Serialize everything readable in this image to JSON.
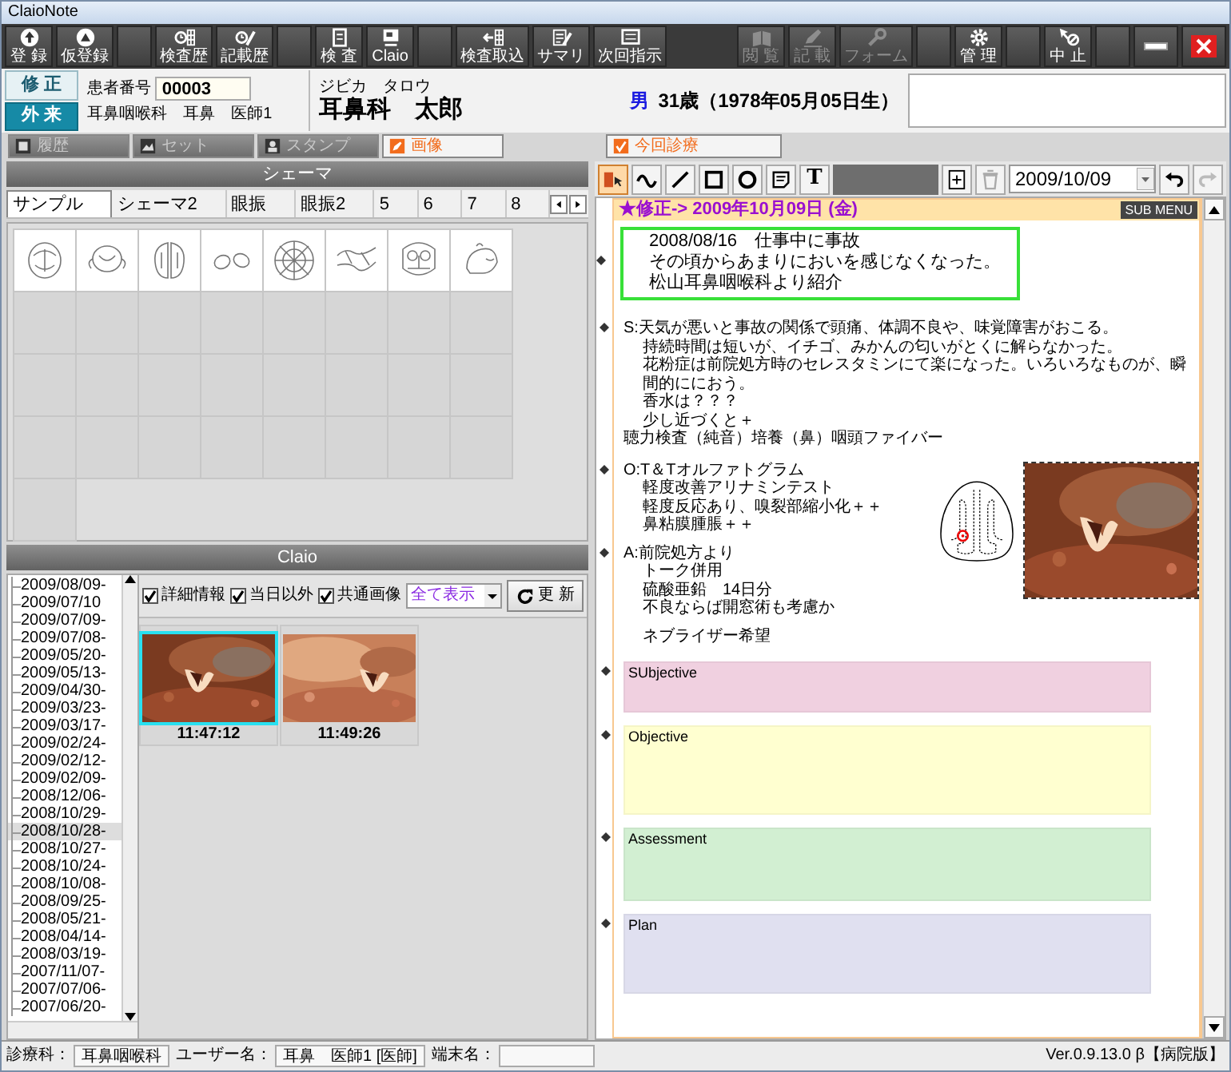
{
  "window": {
    "title": "ClaioNote"
  },
  "toolbar_groups": [
    [
      {
        "label": "登 録",
        "disabled": false
      },
      {
        "label": "仮登録",
        "disabled": false
      }
    ],
    [
      {
        "label": "検査歴",
        "disabled": false
      },
      {
        "label": "記載歴",
        "disabled": false
      }
    ],
    [
      {
        "label": "検 査",
        "disabled": false
      },
      {
        "label": "Claio",
        "disabled": false
      }
    ],
    [
      {
        "label": "検査取込",
        "disabled": false
      },
      {
        "label": "サマリ",
        "disabled": false
      },
      {
        "label": "次回指示",
        "disabled": false
      }
    ],
    [
      {
        "label": "閲 覧",
        "disabled": true
      },
      {
        "label": "記 載",
        "disabled": true
      },
      {
        "label": "フォーム",
        "disabled": true
      }
    ],
    [
      {
        "label": "管 理",
        "disabled": false
      }
    ],
    [
      {
        "label": "中 止",
        "disabled": false
      }
    ]
  ],
  "patient": {
    "edit_button": "修 正",
    "visit_button": "外 来",
    "id_label": "患者番号",
    "id": "00003",
    "department": "耳鼻咽喉科　耳鼻　医師1",
    "kana": "ジビカ　タロウ",
    "name": "耳鼻科　太郎",
    "sex": "男",
    "age": "31歳（1978年05月05日生）"
  },
  "tabs": [
    {
      "label": "履歴",
      "selected": false
    },
    {
      "label": "セット",
      "selected": false
    },
    {
      "label": "スタンプ",
      "selected": false
    },
    {
      "label": "画像",
      "selected": true
    }
  ],
  "chart_tab": {
    "label": "今回診療",
    "selected": true
  },
  "schema": {
    "title": "シェーマ",
    "tabs": [
      {
        "label": "サンプル",
        "selected": true
      },
      {
        "label": "シェーマ2",
        "selected": false
      },
      {
        "label": "眼振",
        "selected": false
      },
      {
        "label": "眼振2",
        "selected": false
      },
      {
        "label": "5",
        "selected": false
      },
      {
        "label": "6",
        "selected": false
      },
      {
        "label": "7",
        "selected": false
      },
      {
        "label": "8",
        "selected": false
      }
    ],
    "items": [
      {
        "kind": "mouth"
      },
      {
        "kind": "ears"
      },
      {
        "kind": "nose"
      },
      {
        "kind": "eyes"
      },
      {
        "kind": "target"
      },
      {
        "kind": "canal"
      },
      {
        "kind": "skull"
      },
      {
        "kind": "head"
      }
    ]
  },
  "claio": {
    "title": "Claio",
    "dates": [
      {
        "label": "2009/08/09-",
        "selected": false
      },
      {
        "label": "2009/07/10",
        "selected": false
      },
      {
        "label": "2009/07/09-",
        "selected": false
      },
      {
        "label": "2009/07/08-",
        "selected": false
      },
      {
        "label": "2009/05/20-",
        "selected": false
      },
      {
        "label": "2009/05/13-",
        "selected": false
      },
      {
        "label": "2009/04/30-",
        "selected": false
      },
      {
        "label": "2009/03/23-",
        "selected": false
      },
      {
        "label": "2009/03/17-",
        "selected": false
      },
      {
        "label": "2009/02/24-",
        "selected": false
      },
      {
        "label": "2009/02/12-",
        "selected": false
      },
      {
        "label": "2009/02/09-",
        "selected": false
      },
      {
        "label": "2008/12/06-",
        "selected": false
      },
      {
        "label": "2008/10/29-",
        "selected": false
      },
      {
        "label": "2008/10/28-",
        "selected": true
      },
      {
        "label": "2008/10/27-",
        "selected": false
      },
      {
        "label": "2008/10/24-",
        "selected": false
      },
      {
        "label": "2008/10/08-",
        "selected": false
      },
      {
        "label": "2008/09/25-",
        "selected": false
      },
      {
        "label": "2008/05/21-",
        "selected": false
      },
      {
        "label": "2008/04/14-",
        "selected": false
      },
      {
        "label": "2008/03/19-",
        "selected": false
      },
      {
        "label": "2007/11/07-",
        "selected": false
      },
      {
        "label": "2007/07/06-",
        "selected": false
      },
      {
        "label": "2007/06/20-",
        "selected": false
      }
    ],
    "filters": [
      {
        "label": "詳細情報",
        "checked": true
      },
      {
        "label": "当日以外",
        "checked": true
      },
      {
        "label": "共通画像",
        "checked": true
      }
    ],
    "view": "全て表示",
    "refresh_button": "更 新",
    "images": [
      {
        "time": "11:47:12",
        "selected": true
      },
      {
        "time": "11:49:26",
        "selected": false
      }
    ]
  },
  "chart": {
    "tools": [
      {
        "selected": true
      },
      {
        "selected": false
      },
      {
        "selected": false
      },
      {
        "selected": false
      },
      {
        "selected": false
      },
      {
        "selected": false
      },
      {
        "selected": false,
        "label": "T"
      }
    ],
    "delete_disabled": true,
    "date": "2009/10/09",
    "undo_disabled": false,
    "redo_disabled": true,
    "header": "★修正-> 2009年10月09日 (金)",
    "sub_menu": "SUB MENU",
    "boxed_lines": [
      {
        "text": "2008/08/16　仕事中に事故",
        "marked": false
      },
      {
        "text": "その頃からあまりにおいを感じなくなった。",
        "marked": true
      },
      {
        "text": "松山耳鼻咽喉科より紹介",
        "marked": false
      }
    ],
    "history": [
      {
        "text": "S:天気が悪いと事故の関係で頭痛、体調不良や、味覚障害がおこる。",
        "marked": true,
        "indented": false
      },
      {
        "text": "持続時間は短いが、イチゴ、みかんの匂いがとくに解らなかった。",
        "marked": false,
        "indented": true
      },
      {
        "text": "花粉症は前院処方時のセレスタミンにて楽になった。いろいろなものが、瞬間的ににおう。",
        "marked": false,
        "indented": true
      },
      {
        "text": "香水は？？？",
        "marked": false,
        "indented": true
      },
      {
        "text": "少し近づくと＋",
        "marked": false,
        "indented": true
      },
      {
        "text": "聴力検査（純音）培養（鼻）咽頭ファイバー",
        "marked": false,
        "indented": false
      }
    ],
    "findings": [
      [
        {
          "text": "O:T＆Tオルファトグラム",
          "marked": true,
          "indented": false
        },
        {
          "text": "軽度改善アリナミンテスト",
          "marked": false,
          "indented": true
        },
        {
          "text": "軽度反応あり、嗅裂部縮小化＋＋",
          "marked": false,
          "indented": true
        },
        {
          "text": "鼻粘膜腫脹＋＋",
          "marked": false,
          "indented": true
        }
      ],
      [
        {
          "text": "A:前院処方より",
          "marked": true,
          "indented": false
        },
        {
          "text": "トーク併用",
          "marked": false,
          "indented": true
        },
        {
          "text": "硫酸亜鉛　14日分",
          "marked": false,
          "indented": true
        },
        {
          "text": "不良ならば開窓術も考慮か",
          "marked": false,
          "indented": true
        }
      ],
      [
        {
          "text": "ネブライザー希望",
          "marked": false,
          "indented": true
        }
      ]
    ],
    "sections": [
      {
        "label": "SUbjective",
        "color": "#f0d0e0",
        "marked": true
      },
      {
        "label": "Objective",
        "color": "#ffffd0",
        "marked": true
      },
      {
        "label": "Assessment",
        "color": "#d2efd2",
        "marked": true
      },
      {
        "label": "Plan",
        "color": "#e0e0f0",
        "marked": true
      }
    ]
  },
  "status_bar": {
    "fields": [
      {
        "label": "診療科：",
        "value": "耳鼻咽喉科"
      },
      {
        "label": "ユーザー名：",
        "value": "耳鼻　医師1 [医師]"
      },
      {
        "label": "端末名："
      }
    ],
    "version": "Ver.0.9.13.0 β【病院版】"
  }
}
